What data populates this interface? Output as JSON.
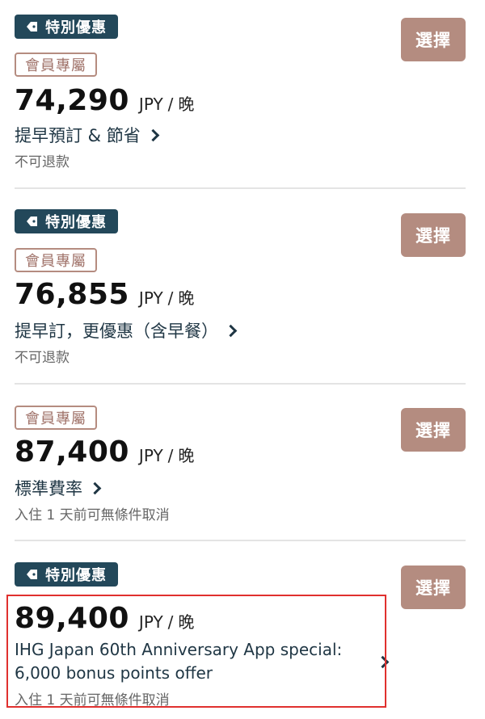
{
  "rates": [
    {
      "special_tag": "特別優惠",
      "member_tag": "會員專屬",
      "price": "74,290",
      "currency": "JPY",
      "separator": "/",
      "per": "晚",
      "name": "提早預訂 & 節省",
      "policy": "不可退款",
      "select_label": "選擇"
    },
    {
      "special_tag": "特別優惠",
      "member_tag": "會員專屬",
      "price": "76,855",
      "currency": "JPY",
      "separator": "/",
      "per": "晚",
      "name": "提早訂，更優惠（含早餐）",
      "policy": "不可退款",
      "select_label": "選擇"
    },
    {
      "member_tag": "會員專屬",
      "price": "87,400",
      "currency": "JPY",
      "separator": "/",
      "per": "晚",
      "name": "標準費率",
      "policy": "入住 1 天前可無條件取消",
      "select_label": "選擇"
    },
    {
      "special_tag": "特別優惠",
      "price": "89,400",
      "currency": "JPY",
      "separator": "/",
      "per": "晚",
      "name_line1": "IHG Japan 60th Anniversary App special:",
      "name_line2": "6,000 bonus points offer",
      "policy": "入住 1 天前可無條件取消",
      "select_label": "選擇"
    }
  ],
  "colors": {
    "special_tag_bg": "#23485a",
    "member_tag_border": "#b58c80",
    "select_button_bg": "#b48c80",
    "highlight_border": "#e0302e"
  }
}
